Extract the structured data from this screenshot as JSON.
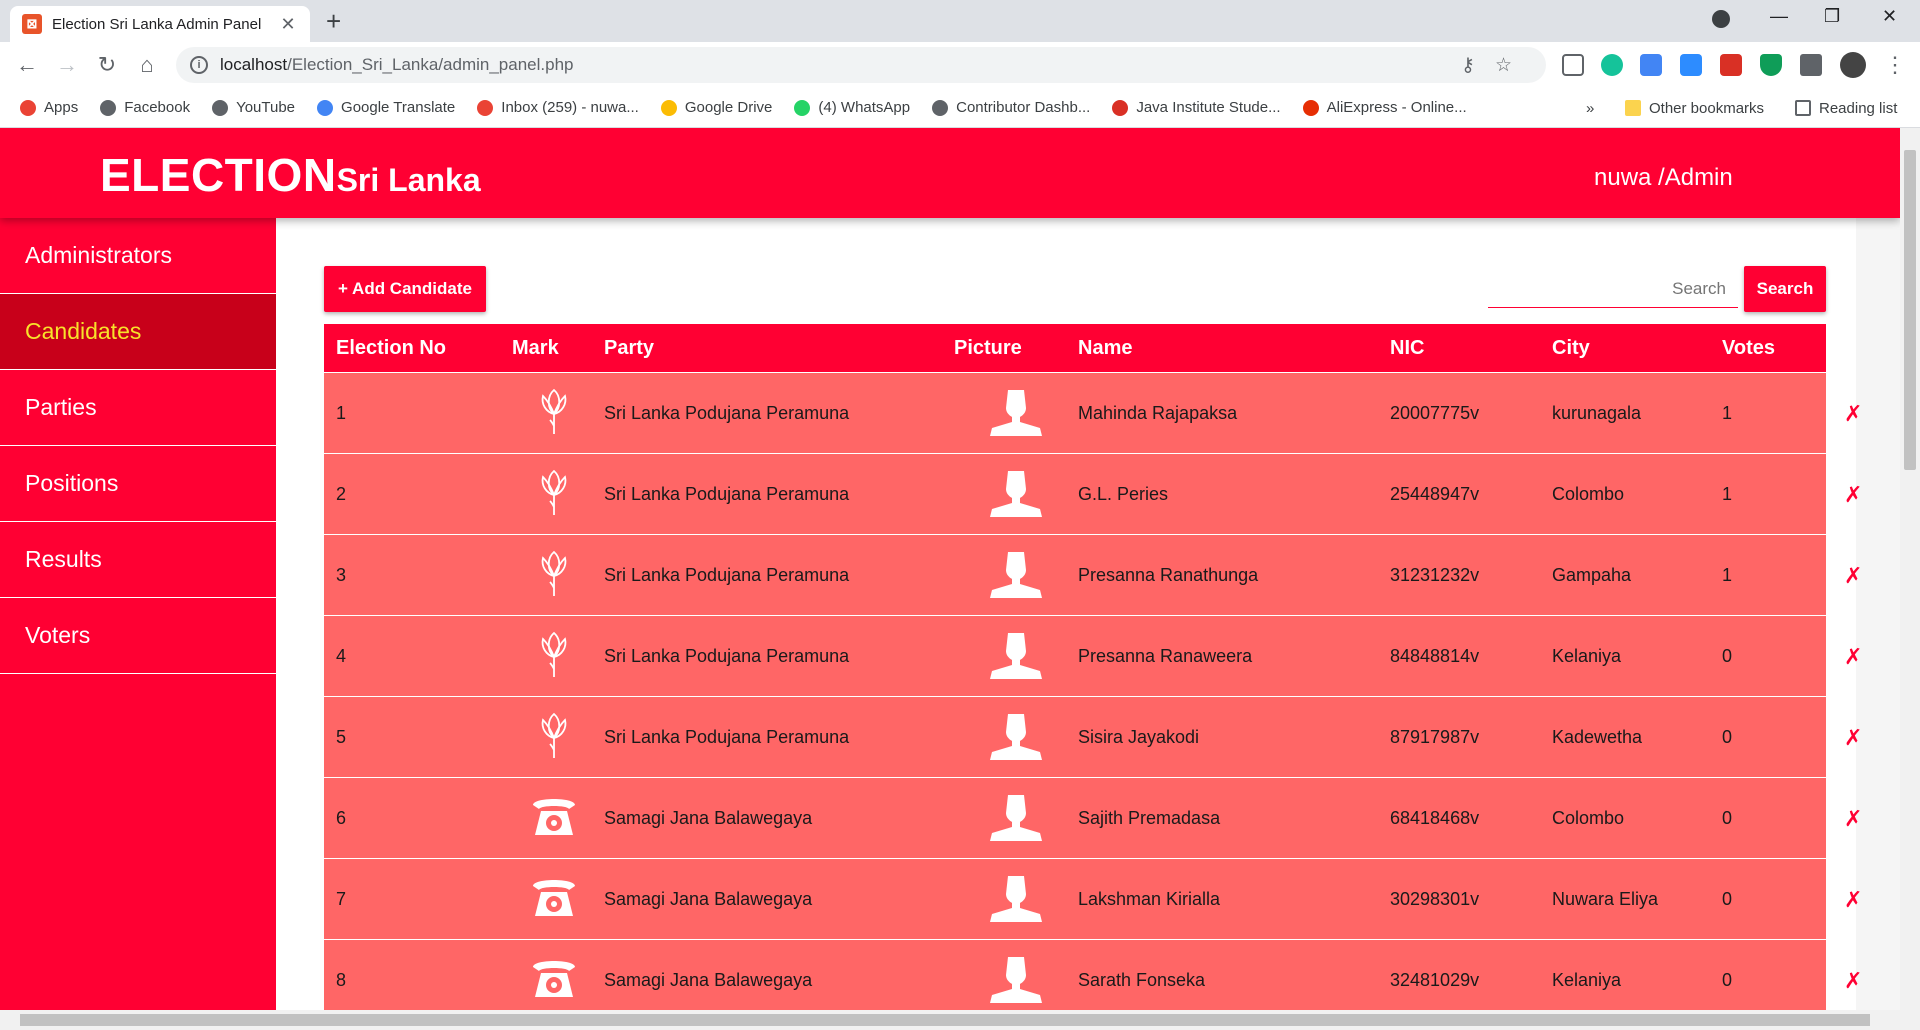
{
  "browser": {
    "tab_title": "Election Sri Lanka Admin Panel",
    "url_host": "localhost",
    "url_path": "/Election_Sri_Lanka/admin_panel.php",
    "bookmarks": [
      {
        "label": "Apps",
        "color": "#ea4335"
      },
      {
        "label": "Facebook",
        "color": "#5f6368"
      },
      {
        "label": "YouTube",
        "color": "#5f6368"
      },
      {
        "label": "Google Translate",
        "color": "#4285f4"
      },
      {
        "label": "Inbox (259) - nuwa...",
        "color": "#ea4335"
      },
      {
        "label": "Google Drive",
        "color": "#fbbc04"
      },
      {
        "label": "(4) WhatsApp",
        "color": "#25d366"
      },
      {
        "label": "Contributor Dashb...",
        "color": "#5f6368"
      },
      {
        "label": "Java Institute Stude...",
        "color": "#d93025"
      },
      {
        "label": "AliExpress - Online...",
        "color": "#e62e04"
      }
    ],
    "other_bookmarks": "Other bookmarks",
    "reading_list": "Reading list",
    "overflow": "»"
  },
  "app": {
    "brand_main": "ELECTION",
    "brand_sub": "Sri Lanka",
    "user": "nuwa /Admin",
    "accent": "#ff0033",
    "row_color": "#ff6666",
    "active_text": "#f8e22a"
  },
  "sidebar": {
    "items": [
      {
        "label": "Administrators",
        "active": false
      },
      {
        "label": "Candidates",
        "active": true
      },
      {
        "label": "Parties",
        "active": false
      },
      {
        "label": "Positions",
        "active": false
      },
      {
        "label": "Results",
        "active": false
      },
      {
        "label": "Voters",
        "active": false
      }
    ]
  },
  "actions": {
    "add_label": "+ Add Candidate",
    "search_placeholder": "Search",
    "search_label": "Search"
  },
  "table": {
    "columns": [
      "Election No",
      "Mark",
      "Party",
      "Picture",
      "Name",
      "NIC",
      "City",
      "Votes"
    ],
    "delete_glyph": "✗",
    "rows": [
      {
        "no": "1",
        "mark": "lotus-icon",
        "party": "Sri Lanka Podujana Peramuna",
        "name": "Mahinda Rajapaksa",
        "nic": "20007775v",
        "city": "kurunagala",
        "votes": "1"
      },
      {
        "no": "2",
        "mark": "lotus-icon",
        "party": "Sri Lanka Podujana Peramuna",
        "name": "G.L. Peries",
        "nic": "25448947v",
        "city": "Colombo",
        "votes": "1"
      },
      {
        "no": "3",
        "mark": "lotus-icon",
        "party": "Sri Lanka Podujana Peramuna",
        "name": "Presanna Ranathunga",
        "nic": "31231232v",
        "city": "Gampaha",
        "votes": "1"
      },
      {
        "no": "4",
        "mark": "lotus-icon",
        "party": "Sri Lanka Podujana Peramuna",
        "name": "Presanna Ranaweera",
        "nic": "84848814v",
        "city": "Kelaniya",
        "votes": "0"
      },
      {
        "no": "5",
        "mark": "lotus-icon",
        "party": "Sri Lanka Podujana Peramuna",
        "name": "Sisira Jayakodi",
        "nic": "87917987v",
        "city": "Kadewetha",
        "votes": "0"
      },
      {
        "no": "6",
        "mark": "telephone-icon",
        "party": "Samagi Jana Balawegaya",
        "name": "Sajith Premadasa",
        "nic": "68418468v",
        "city": "Colombo",
        "votes": "0"
      },
      {
        "no": "7",
        "mark": "telephone-icon",
        "party": "Samagi Jana Balawegaya",
        "name": "Lakshman Kirialla",
        "nic": "30298301v",
        "city": "Nuwara Eliya",
        "votes": "0"
      },
      {
        "no": "8",
        "mark": "telephone-icon",
        "party": "Samagi Jana Balawegaya",
        "name": "Sarath Fonseka",
        "nic": "32481029v",
        "city": "Kelaniya",
        "votes": "0"
      }
    ]
  }
}
